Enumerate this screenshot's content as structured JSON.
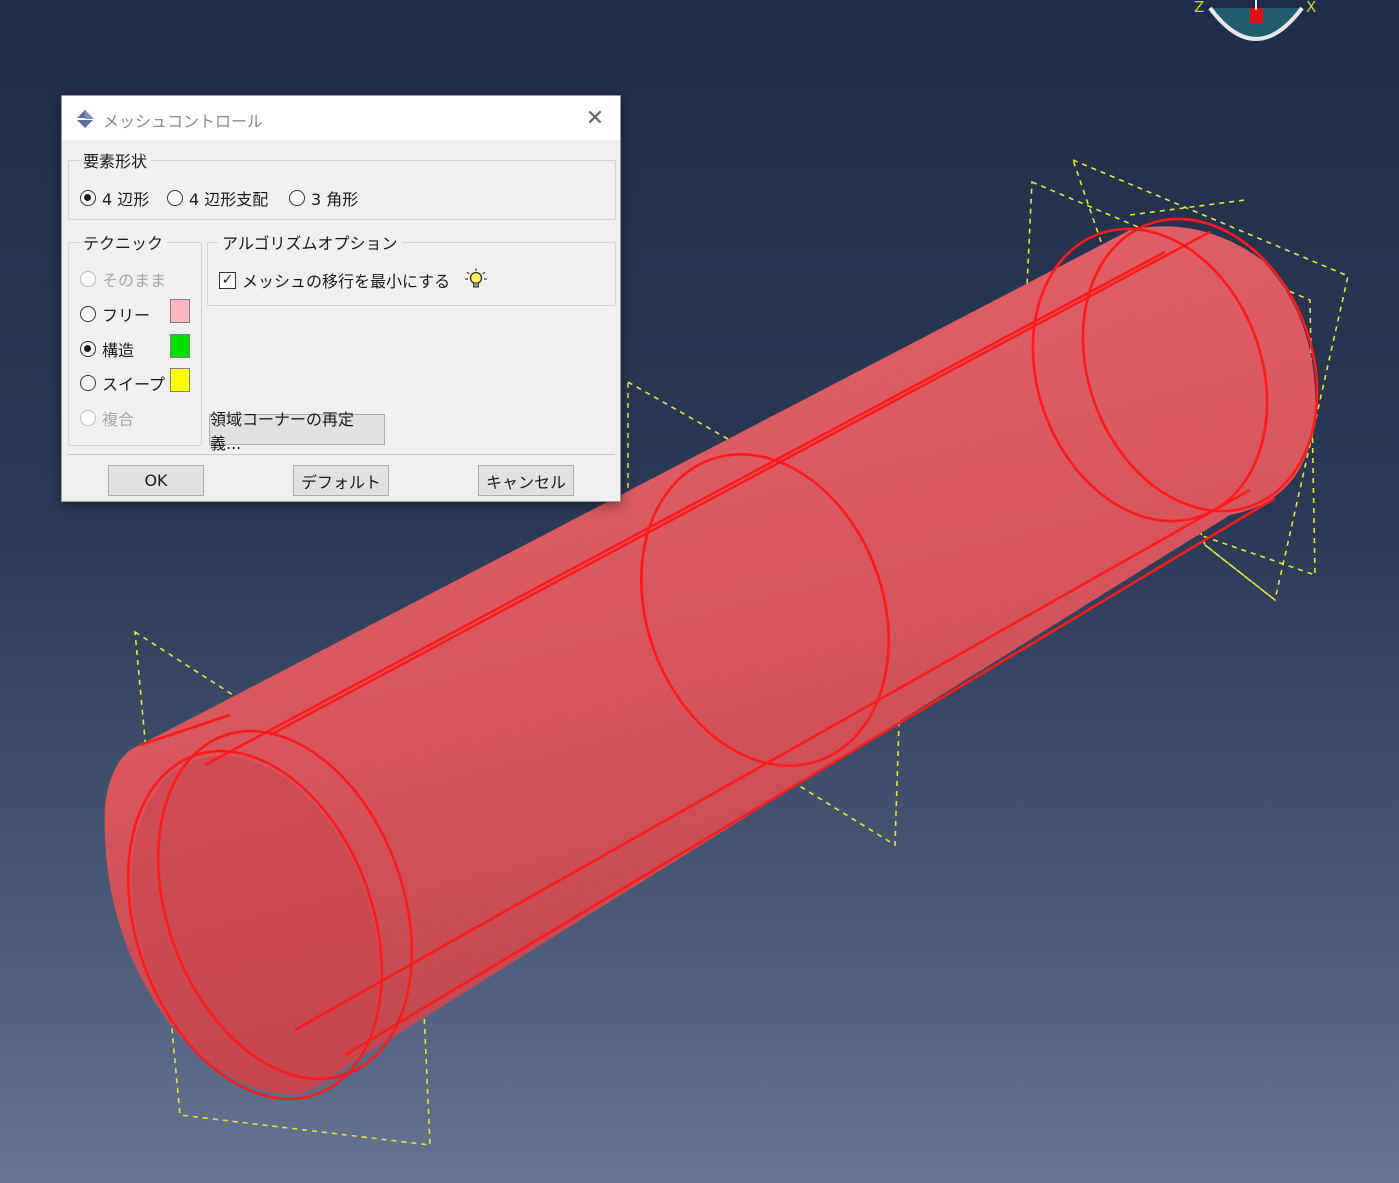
{
  "dialog": {
    "title": "メッシュコントロール",
    "element_shape": {
      "legend": "要素形状",
      "options": [
        {
          "label": "4 辺形",
          "selected": true
        },
        {
          "label": "4 辺形支配",
          "selected": false
        },
        {
          "label": "3 角形",
          "selected": false
        }
      ]
    },
    "technique": {
      "legend": "テクニック",
      "options": [
        {
          "label": "そのまま",
          "selected": false,
          "enabled": false
        },
        {
          "label": "フリー",
          "selected": false,
          "enabled": true,
          "color": "#ffb6c1"
        },
        {
          "label": "構造",
          "selected": true,
          "enabled": true,
          "color": "#00e000"
        },
        {
          "label": "スイープ",
          "selected": false,
          "enabled": true,
          "color": "#ffff00"
        },
        {
          "label": "複合",
          "selected": false,
          "enabled": false
        }
      ]
    },
    "algorithm": {
      "legend": "アルゴリズムオプション",
      "minimize_transition_label": "メッシュの移行を最小にする",
      "minimize_transition_checked": true,
      "hint_icon": "lightbulb-icon"
    },
    "redefine_corners_label": "領域コーナーの再定義...",
    "buttons": {
      "ok": "OK",
      "default": "デフォルト",
      "cancel": "キャンセル"
    }
  },
  "compass": {
    "axis_z": "Z",
    "axis_x": "X"
  },
  "model": {
    "shape": "cylinder",
    "fill_color": "#e0545c",
    "edge_color": "#ff1a1a",
    "partition_plane_color": "#e8e83a",
    "mesh_technique_shown": "フリー"
  }
}
